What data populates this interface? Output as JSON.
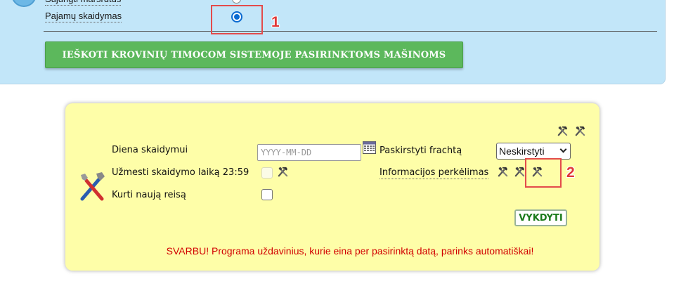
{
  "top": {
    "cut_label": "Sujungti maršrutus",
    "split_label": "Pajamų skaidymas",
    "split_radio_checked": true,
    "search_button": "IEŠKOTI KROVINIŲ TIMOCOM SISTEMOJE PASIRINKTOMS MAŠINOMS"
  },
  "annotations": {
    "one": "1",
    "two": "2"
  },
  "form": {
    "date_label": "Diena skaidymui",
    "date_placeholder": "YYYY-MM-DD",
    "date_value": "",
    "set_time_label": "Užmesti skaidymo laiką 23:59",
    "set_time_checked": false,
    "new_trip_label": "Kurti naują reisą",
    "new_trip_checked": false,
    "freight_label": "Paskirstyti frachtą",
    "freight_select_value": "Neskirstyti",
    "transfer_label": "Informacijos perkėlimas",
    "run_button": "VYKDYTI",
    "warning": "SVARBU! Programa uždavinius, kurie eina per pasirinktą datą, parinks automatiškai!"
  },
  "colors": {
    "top_panel": "#c2e6f9",
    "yellow_panel": "#fefea8",
    "search_button": "#5cb85c",
    "warning_text": "#d10000",
    "annotation": "#e34b4b"
  },
  "icons": [
    "tools-icon",
    "calendar-icon",
    "hammer-icon"
  ]
}
